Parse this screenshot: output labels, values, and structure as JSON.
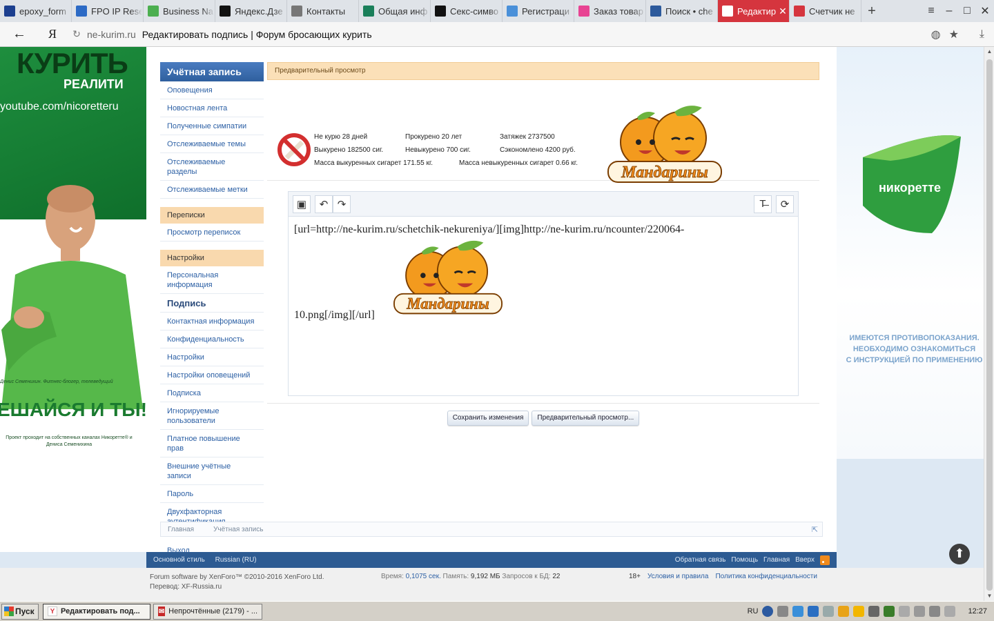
{
  "browser": {
    "tabs": [
      {
        "title": "epoxy_form",
        "icon": "h-icon",
        "color": "#1c3f8f"
      },
      {
        "title": "FPO IP Rese",
        "icon": "fpo-icon",
        "color": "#2c6ac5"
      },
      {
        "title": "Business Na",
        "icon": "business-icon",
        "color": "#4caf50"
      },
      {
        "title": "Яндекс.Дзе",
        "icon": "zen-icon",
        "color": "#111111"
      },
      {
        "title": "Контакты",
        "icon": "page-icon",
        "color": "#777777"
      },
      {
        "title": "Общая инф",
        "icon": "chart-icon",
        "color": "#1a7f5a"
      },
      {
        "title": "Секс-симво",
        "icon": "m-icon",
        "color": "#111111"
      },
      {
        "title": "Регистраци",
        "icon": "star-icon",
        "color": "#4a90d9"
      },
      {
        "title": "Заказ товар",
        "icon": "flower-icon",
        "color": "#e84393"
      },
      {
        "title": "Поиск • che",
        "icon": "globe-icon",
        "color": "#2c5a9c"
      },
      {
        "title": "Редактир",
        "icon": "pencil-icon",
        "color": "#d5353e",
        "active": true
      },
      {
        "title": "Счетчик не",
        "icon": "shield-icon",
        "color": "#d5353e"
      }
    ],
    "new_tab": "+",
    "address": {
      "domain": "ne-kurim.ru",
      "title": "Редактировать подпись | Форум бросающих курить",
      "yandex_logo": "Я"
    }
  },
  "ad_left": {
    "headline": "КУРИТЬ",
    "subtitle": "РЕАЛИТИ",
    "url": "youtube.com/nicoretteru",
    "caption": "Денис Семенихин. Фитнес-блогер, телеведущий",
    "slogan": "ЕШАЙСЯ И ТЫ!",
    "project": "Проект проходит на собственных каналах Никоретте® и Дениса Семенихина"
  },
  "ad_right": {
    "brand": "никоретте",
    "warning": [
      "ИМЕЮТСЯ ПРОТИВОПОКАЗАНИЯ.",
      "НЕОБХОДИМО ОЗНАКОМИТЬСЯ",
      "С ИНСТРУКЦИЕЙ ПО ПРИМЕНЕНИЮ"
    ]
  },
  "sidebar": {
    "account_title": "Учётная запись",
    "account_items": [
      "Оповещения",
      "Новостная лента",
      "Полученные симпатии",
      "Отслеживаемые темы",
      "Отслеживаемые разделы",
      "Отслеживаемые метки"
    ],
    "conversations_title": "Переписки",
    "conversations_items": [
      "Просмотр переписок"
    ],
    "settings_title": "Настройки",
    "settings_items": [
      "Персональная информация",
      "Подпись",
      "Контактная информация",
      "Конфиденциальность",
      "Настройки",
      "Настройки оповещений",
      "Подписка",
      "Игнорируемые пользователи",
      "Платное повышение прав",
      "Внешние учётные записи",
      "Пароль",
      "Двухфакторная аутентификация"
    ],
    "current_item": "Подпись",
    "logout": "Выход"
  },
  "preview": {
    "header": "Предварительный просмотр",
    "stats": {
      "r1c1": "Не курю 28 дней",
      "r1c2": "Прокурено 20 лет",
      "r1c3": "Затяжек 2737500",
      "r2c1": "Выкурено 182500 сиг.",
      "r2c2": "Невыкурено 700 сиг.",
      "r2c3": "Сэкономлено 4200 руб.",
      "r3c1": "Масса выкуренных сигарет 171.55 кг.",
      "r3c2": "Масса невыкуренных сигарет 0.66 кг."
    },
    "logo_text": "Мандарины"
  },
  "editor": {
    "line1": "[url=http://ne-kurim.ru/schetchik-nekureniya/][img]http://ne-kurim.ru/ncounter/220064-",
    "line2": "10.png[/img][/url]",
    "logo_text": "Мандарины"
  },
  "buttons": {
    "save": "Сохранить изменения",
    "preview": "Предварительный просмотр..."
  },
  "breadcrumb": [
    "Главная",
    "Учётная запись"
  ],
  "footer": {
    "style": "Основной стиль",
    "language": "Russian (RU)",
    "links": [
      "Обратная связь",
      "Помощь",
      "Главная",
      "Вверх"
    ],
    "software": "Forum software by XenForo™ ©2010-2016 XenForo Ltd.",
    "translation": "Перевод: XF-Russia.ru",
    "time_label": "Время:",
    "time_value": "0,1075 сек.",
    "memory_label": "Память:",
    "memory_value": "9,192 МБ",
    "queries_label": "Запросов к БД:",
    "queries_value": "22",
    "age": "18+",
    "terms": "Условия и правила",
    "privacy": "Политика конфиденциальности"
  },
  "taskbar": {
    "start": "Пуск",
    "tasks": [
      "Редактировать под...",
      "Непрочтённые (2179) - ..."
    ],
    "lang": "RU",
    "clock": "12:27"
  }
}
